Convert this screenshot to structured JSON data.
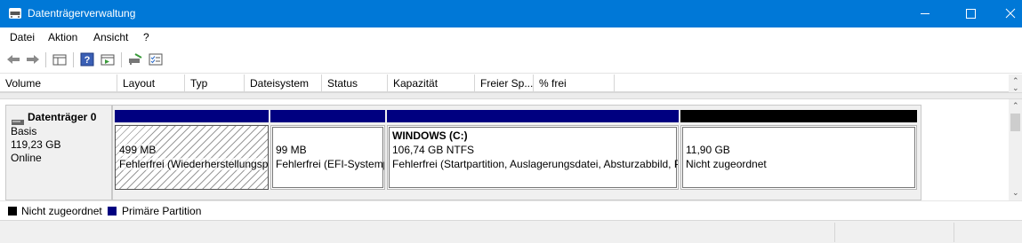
{
  "window": {
    "title": "Datenträgerverwaltung"
  },
  "menu": {
    "items": [
      {
        "label": "Datei"
      },
      {
        "label": "Aktion"
      },
      {
        "label": "Ansicht"
      },
      {
        "label": "?"
      }
    ]
  },
  "toolbar": {
    "icons": [
      "back-arrow-icon",
      "forward-arrow-icon",
      "show-hide-console-tree-icon",
      "help-icon",
      "properties-icon",
      "connect-disk-icon",
      "checklist-icon"
    ]
  },
  "volume_list": {
    "columns": [
      {
        "label": "Volume"
      },
      {
        "label": "Layout"
      },
      {
        "label": "Typ"
      },
      {
        "label": "Dateisystem"
      },
      {
        "label": "Status"
      },
      {
        "label": "Kapazität"
      },
      {
        "label": "Freier Sp..."
      },
      {
        "label": "% frei"
      }
    ]
  },
  "disk": {
    "name": "Datenträger 0",
    "type": "Basis",
    "size": "119,23 GB",
    "status": "Online",
    "partitions": [
      {
        "name": "",
        "size": "499 MB",
        "status": "Fehlerfrei (Wiederherstellungspartition)",
        "kind": "recovery"
      },
      {
        "name": "",
        "size": "99 MB",
        "status": "Fehlerfrei (EFI-Systempartition)",
        "kind": "primary"
      },
      {
        "name": "WINDOWS  (C:)",
        "size": "106,74 GB NTFS",
        "status": "Fehlerfrei (Startpartition, Auslagerungsdatei, Absturzabbild, Primäre Partition)",
        "kind": "primary"
      },
      {
        "name": "",
        "size": "11,90 GB",
        "status": "Nicht zugeordnet",
        "kind": "unallocated"
      }
    ]
  },
  "legend": {
    "items": [
      {
        "label": "Nicht zugeordnet",
        "color": "#000000"
      },
      {
        "label": "Primäre Partition",
        "color": "#000080"
      }
    ]
  },
  "colors": {
    "titlebar": "#0078d7",
    "primary": "#000080",
    "unallocated": "#000000"
  }
}
